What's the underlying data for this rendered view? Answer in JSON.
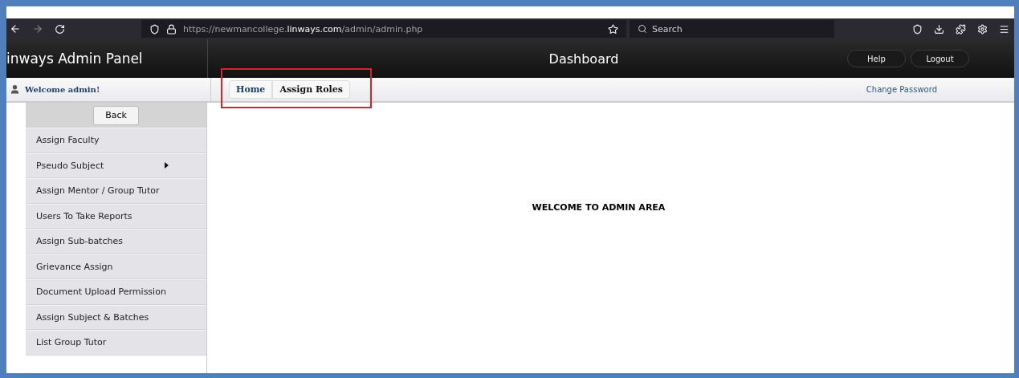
{
  "browser": {
    "url_host": "https://newmancollege.",
    "url_domain": "linways.com",
    "url_path": "/admin/admin.php",
    "search_placeholder": "Search"
  },
  "header": {
    "brand": "inways Admin Panel",
    "title": "Dashboard",
    "buttons": [
      "Help",
      "Logout"
    ]
  },
  "subheader": {
    "welcome": "Welcome admin!",
    "breadcrumb": [
      {
        "label": "Home",
        "current": false
      },
      {
        "label": "Assign Roles",
        "current": true
      }
    ],
    "highlighted": true,
    "change_password": "Change Password"
  },
  "sidebar": {
    "back": "Back",
    "items": [
      {
        "label": "Assign Faculty",
        "has_submenu": false
      },
      {
        "label": "Pseudo Subject",
        "has_submenu": true
      },
      {
        "label": "Assign Mentor / Group Tutor",
        "has_submenu": false
      },
      {
        "label": "Users To Take Reports",
        "has_submenu": false
      },
      {
        "label": "Assign Sub-batches",
        "has_submenu": false
      },
      {
        "label": "Grievance Assign",
        "has_submenu": false
      },
      {
        "label": "Document Upload Permission",
        "has_submenu": false
      },
      {
        "label": "Assign Subject & Batches",
        "has_submenu": false
      },
      {
        "label": "List Group Tutor",
        "has_submenu": false
      }
    ]
  },
  "main": {
    "message": "WELCOME TO ADMIN AREA"
  }
}
